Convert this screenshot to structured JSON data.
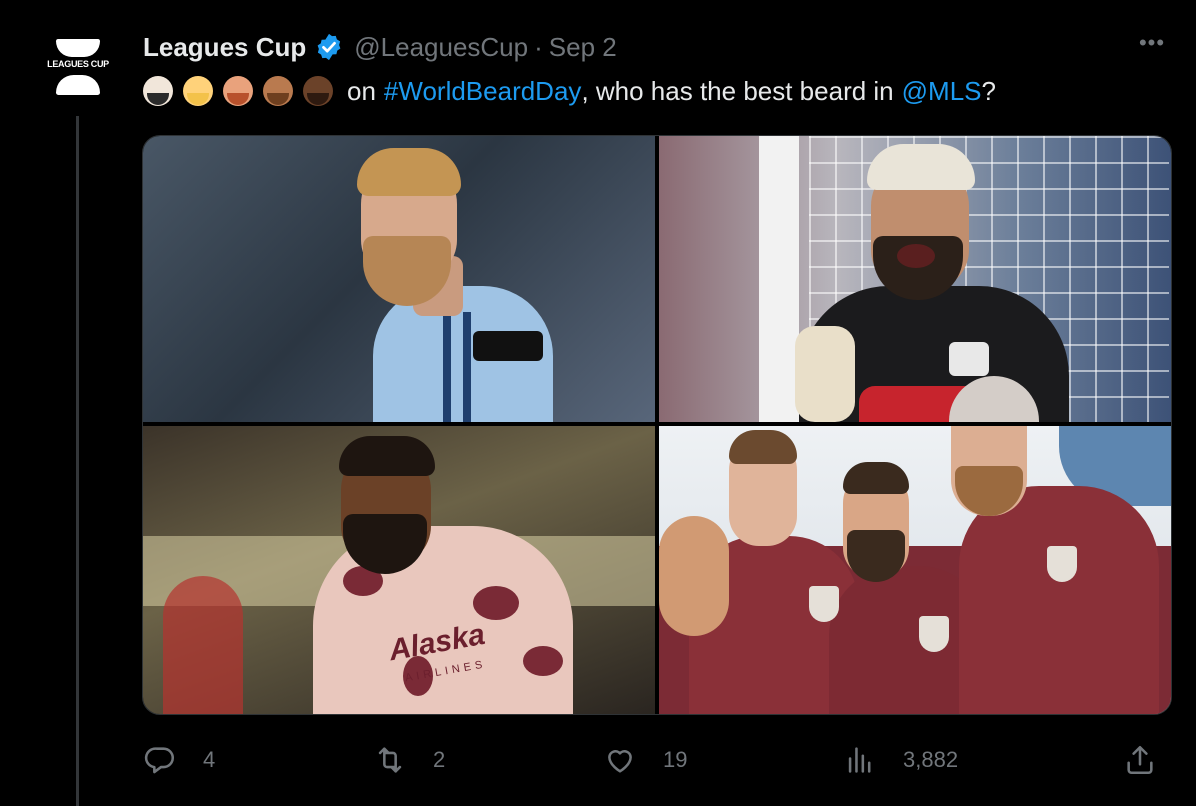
{
  "tweet": {
    "author": {
      "display_name": "Leagues Cup",
      "handle": "@LeaguesCup",
      "verified": true,
      "logo_text": "LEAGUES CUP"
    },
    "separator": "·",
    "date": "Sep 2",
    "text": {
      "emojis": [
        "man-beard-light-emoji",
        "man-beard-blond-emoji",
        "man-beard-red-emoji",
        "man-beard-medium-emoji",
        "man-beard-dark-emoji"
      ],
      "word_on": "on",
      "hashtag": "#WorldBeardDay",
      "middle": ", who has the best beard in",
      "mention": "@MLS",
      "end": "?"
    },
    "media": [
      {
        "kind": "photo"
      },
      {
        "kind": "photo"
      },
      {
        "kind": "photo",
        "jersey_text": "Alaska",
        "jersey_subtext": "AIRLINES"
      },
      {
        "kind": "photo"
      }
    ],
    "actions": {
      "reply_count": "4",
      "retweet_count": "2",
      "like_count": "19",
      "view_count": "3,882"
    }
  },
  "colors": {
    "background": "#000000",
    "text": "#e7e9ea",
    "secondary": "#71767b",
    "link": "#1d9bf0",
    "verified": "#1d9bf0"
  }
}
